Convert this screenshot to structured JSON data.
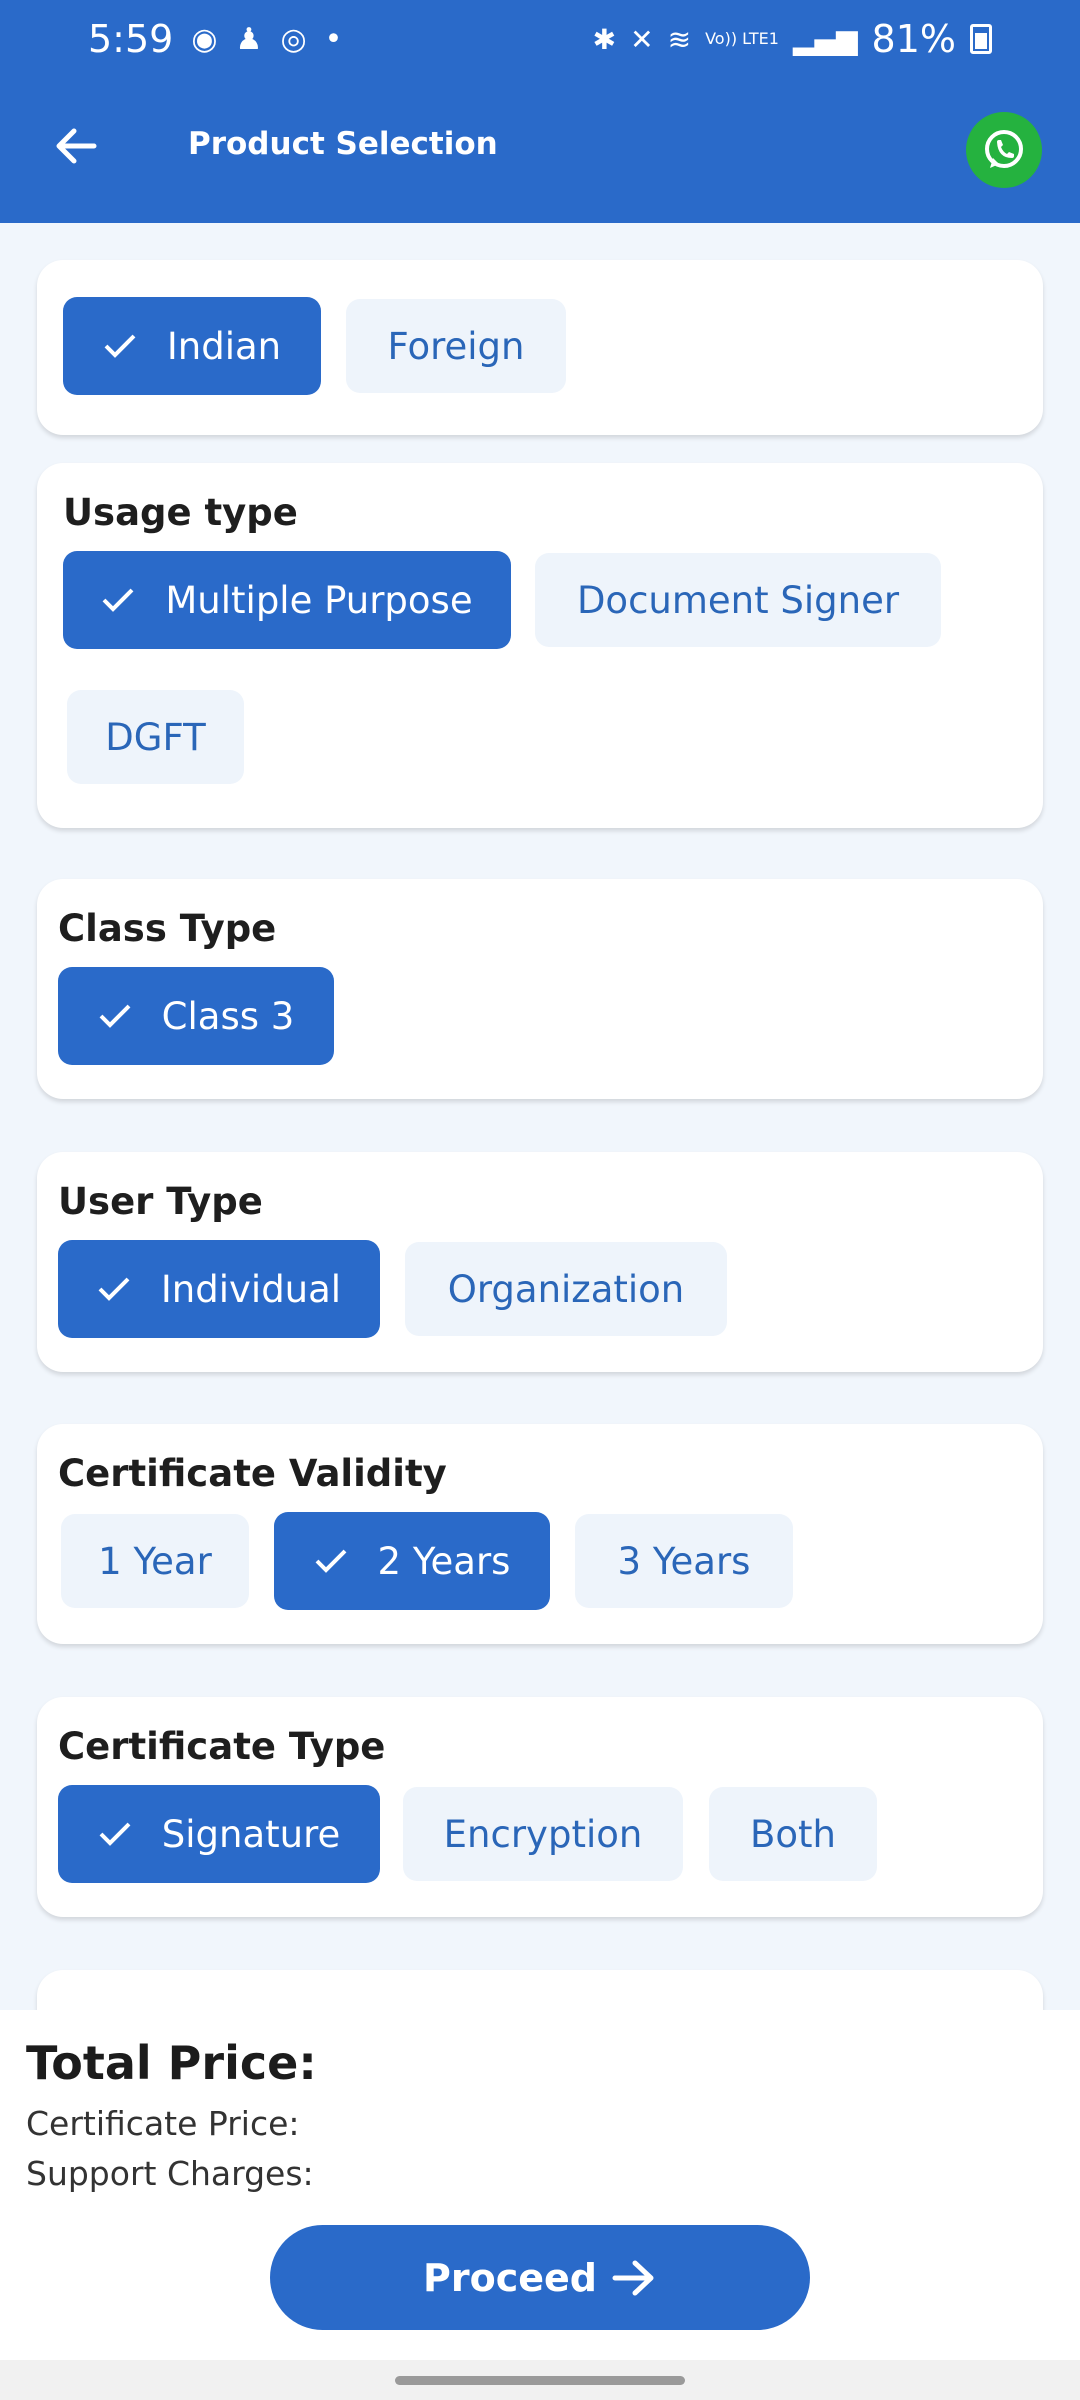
{
  "status_bar": {
    "time": "5:59",
    "network": "Vo)) LTE1",
    "battery": "81%"
  },
  "app_bar": {
    "title": "Product Selection"
  },
  "origin": {
    "options": [
      {
        "label": "Indian",
        "selected": true
      },
      {
        "label": "Foreign",
        "selected": false
      }
    ]
  },
  "usage_type": {
    "title": "Usage type",
    "options": [
      {
        "label": "Multiple Purpose",
        "selected": true
      },
      {
        "label": "Document Signer",
        "selected": false
      },
      {
        "label": "DGFT",
        "selected": false
      }
    ]
  },
  "class_type": {
    "title": "Class Type",
    "options": [
      {
        "label": "Class 3",
        "selected": true
      }
    ]
  },
  "user_type": {
    "title": "User Type",
    "options": [
      {
        "label": "Individual",
        "selected": true
      },
      {
        "label": "Organization",
        "selected": false
      }
    ]
  },
  "certificate_validity": {
    "title": "Certificate Validity",
    "options": [
      {
        "label": "1 Year",
        "selected": false
      },
      {
        "label": "2 Years",
        "selected": true
      },
      {
        "label": "3 Years",
        "selected": false
      }
    ]
  },
  "certificate_type": {
    "title": "Certificate Type",
    "options": [
      {
        "label": "Signature",
        "selected": true
      },
      {
        "label": "Encryption",
        "selected": false
      },
      {
        "label": "Both",
        "selected": false
      }
    ]
  },
  "price": {
    "title": "Total Price:",
    "certificate_price_label": "Certificate Price:",
    "support_charges_label": "Support Charges:"
  },
  "proceed_label": "Proceed",
  "colors": {
    "primary": "#2a6ac9",
    "chip_unselected_bg": "#eef4fb",
    "whatsapp": "#25b23f",
    "background": "#f1f6fc"
  }
}
